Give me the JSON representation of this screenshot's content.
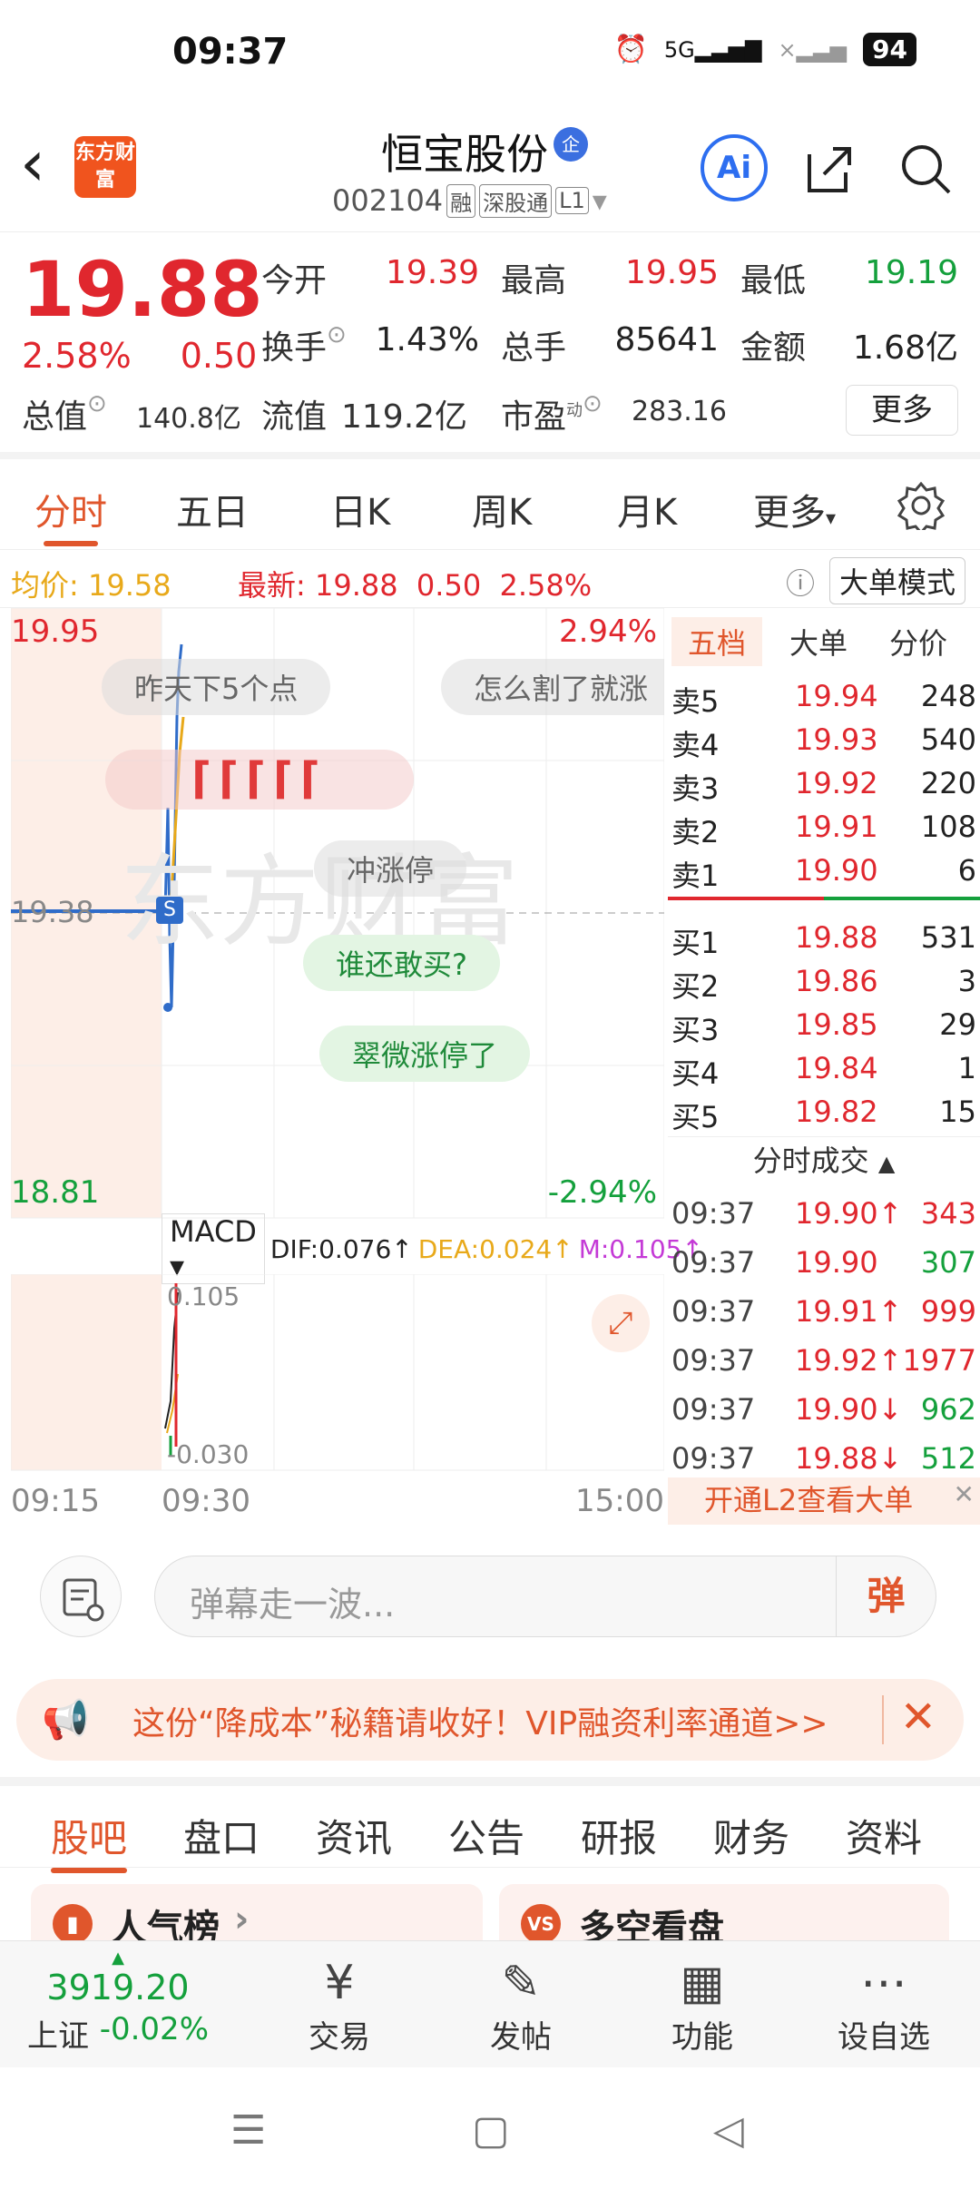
{
  "status_bar": {
    "time": "09:37",
    "network": "5G",
    "battery": "94"
  },
  "header": {
    "stock_name": "恒宝股份",
    "badge": "企",
    "code": "002104",
    "tags": [
      "融",
      "深股通",
      "L1"
    ],
    "ai_label": "Ai",
    "logo_text": "东方财富"
  },
  "quote": {
    "price": "19.88",
    "change_pct": "2.58%",
    "change": "0.50",
    "labels": {
      "open": "今开",
      "high": "最高",
      "low": "最低",
      "turnover": "换手",
      "volume": "总手",
      "amount": "金额",
      "total_cap": "总值",
      "float_cap": "流值",
      "pe": "市盈"
    },
    "open": "19.39",
    "high": "19.95",
    "low": "19.19",
    "turnover": "1.43%",
    "volume": "85641",
    "amount": "1.68亿",
    "total_cap": "140.8亿",
    "float_cap": "119.2亿",
    "pe": "283.16",
    "pe_sup": "动",
    "more_label": "更多"
  },
  "chart_tabs": [
    "分时",
    "五日",
    "日K",
    "周K",
    "月K",
    "更多"
  ],
  "avg_bar": {
    "avg_label": "均价:",
    "avg": "19.58",
    "latest_label": "最新:",
    "latest": "19.88",
    "change": "0.50",
    "change_pct": "2.58%",
    "big_order_mode": "大单模式"
  },
  "chart": {
    "top_price": "19.95",
    "top_pct": "2.94%",
    "prev_close": "19.38",
    "bottom_price": "18.81",
    "bottom_pct": "-2.94%",
    "bubbles": [
      "昨天下5个点",
      "怎么割了就涨",
      "冲涨停",
      "谁还敢买?",
      "翠微涨停了"
    ],
    "macd": {
      "label": "MACD",
      "dif": "DIF:0.076↑",
      "dea": "DEA:0.024↑",
      "m": "M:0.105↑",
      "top": "0.105",
      "bottom": "-0.030"
    },
    "time_axis": [
      "09:15",
      "09:30",
      "15:00"
    ]
  },
  "order_book": {
    "tabs": [
      "五档",
      "大单",
      "分价"
    ],
    "asks": [
      {
        "label": "卖5",
        "price": "19.94",
        "qty": "248"
      },
      {
        "label": "卖4",
        "price": "19.93",
        "qty": "540"
      },
      {
        "label": "卖3",
        "price": "19.92",
        "qty": "220"
      },
      {
        "label": "卖2",
        "price": "19.91",
        "qty": "108"
      },
      {
        "label": "卖1",
        "price": "19.90",
        "qty": "6"
      }
    ],
    "bids": [
      {
        "label": "买1",
        "price": "19.88",
        "qty": "531"
      },
      {
        "label": "买2",
        "price": "19.86",
        "qty": "3"
      },
      {
        "label": "买3",
        "price": "19.85",
        "qty": "29"
      },
      {
        "label": "买4",
        "price": "19.84",
        "qty": "1"
      },
      {
        "label": "买5",
        "price": "19.82",
        "qty": "15"
      }
    ],
    "trades_title": "分时成交",
    "trades": [
      {
        "time": "09:37",
        "price": "19.90↑",
        "qty": "343",
        "qty_color": "red"
      },
      {
        "time": "09:37",
        "price": "19.90",
        "qty": "307",
        "qty_color": "green"
      },
      {
        "time": "09:37",
        "price": "19.91↑",
        "qty": "999",
        "qty_color": "red"
      },
      {
        "time": "09:37",
        "price": "19.92↑",
        "qty": "1977",
        "qty_color": "red"
      },
      {
        "time": "09:37",
        "price": "19.90↓",
        "qty": "962",
        "qty_color": "green"
      },
      {
        "time": "09:37",
        "price": "19.88↓",
        "qty": "512",
        "qty_color": "green"
      }
    ],
    "l2_banner": "开通L2查看大单"
  },
  "comment": {
    "placeholder": "弹幕走一波...",
    "button": "弹"
  },
  "promo": {
    "text": "这份“降成本”秘籍请收好！VIP融资利率通道>>"
  },
  "community_tabs": [
    "股吧",
    "盘口",
    "资讯",
    "公告",
    "研报",
    "财务",
    "资料"
  ],
  "cards": [
    "人气榜",
    "多空看盘"
  ],
  "bottom_bar": {
    "index_value": "3919.20",
    "index_name": "上证",
    "index_change": "-0.02%",
    "items": [
      "交易",
      "发帖",
      "功能",
      "设自选"
    ]
  },
  "colors": {
    "up": "#e0272e",
    "down": "#14a03c",
    "accent": "#e0562c"
  }
}
